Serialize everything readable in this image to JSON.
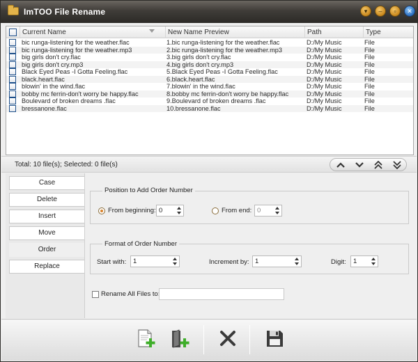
{
  "window": {
    "title": "ImTOO File Rename"
  },
  "list": {
    "columns": [
      "Current Name",
      "New Name Preview",
      "Path",
      "Type"
    ],
    "rows": [
      {
        "current": "bic runga-listening for the weather.flac",
        "preview": "1.bic runga-listening for the weather.flac",
        "path": "D:/My Music",
        "type": "File"
      },
      {
        "current": "bic runga-listening for the weather.mp3",
        "preview": "2.bic runga-listening for the weather.mp3",
        "path": "D:/My Music",
        "type": "File"
      },
      {
        "current": "big girls don't cry.flac",
        "preview": "3.big girls don't cry.flac",
        "path": "D:/My Music",
        "type": "File"
      },
      {
        "current": "big girls don't cry.mp3",
        "preview": "4.big girls don't cry.mp3",
        "path": "D:/My Music",
        "type": "File"
      },
      {
        "current": "Black Eyed Peas -I Gotta Feeling.flac",
        "preview": "5.Black Eyed Peas -I Gotta Feeling.flac",
        "path": "D:/My Music",
        "type": "File"
      },
      {
        "current": "black.heart.flac",
        "preview": "6.black.heart.flac",
        "path": "D:/My Music",
        "type": "File"
      },
      {
        "current": "blowin' in the wind.flac",
        "preview": "7.blowin' in the wind.flac",
        "path": "D:/My Music",
        "type": "File"
      },
      {
        "current": "bobby mc ferrin-don't worry be happy.flac",
        "preview": "8.bobby mc ferrin-don't worry be happy.flac",
        "path": "D:/My Music",
        "type": "File"
      },
      {
        "current": "Boulevard of broken dreams .flac",
        "preview": "9.Boulevard of broken dreams .flac",
        "path": "D:/My Music",
        "type": "File"
      },
      {
        "current": "bressanone.flac",
        "preview": "10.bressanone.flac",
        "path": "D:/My Music",
        "type": "File"
      }
    ]
  },
  "status": {
    "total": "Total: 10 file(s); Selected: 0 file(s)"
  },
  "nav": {
    "icons": [
      "arrow-up-icon",
      "arrow-down-icon",
      "move-top-icon",
      "move-bottom-icon"
    ]
  },
  "tabs": [
    "Case",
    "Delete",
    "Insert",
    "Move",
    "Order",
    "Replace"
  ],
  "active_tab": "Order",
  "order": {
    "position_legend": "Position to Add Order Number",
    "from_beginning_label": "From beginning:",
    "from_beginning_value": "0",
    "from_end_label": "From end:",
    "from_end_value": "0",
    "format_legend": "Format of Order Number",
    "start_with_label": "Start with:",
    "start_with_value": "1",
    "increment_label": "Increment by:",
    "increment_value": "1",
    "digit_label": "Digit:",
    "digit_value": "1",
    "rename_all_label": "Rename All Files to:",
    "rename_all_value": ""
  },
  "toolbar": {
    "icons": [
      "add-file-icon",
      "add-folder-icon",
      "delete-icon",
      "save-icon"
    ]
  },
  "colors": {
    "titlebar": "#3f3c38",
    "accent": "#d9822b",
    "add_green": "#3fae2a"
  }
}
